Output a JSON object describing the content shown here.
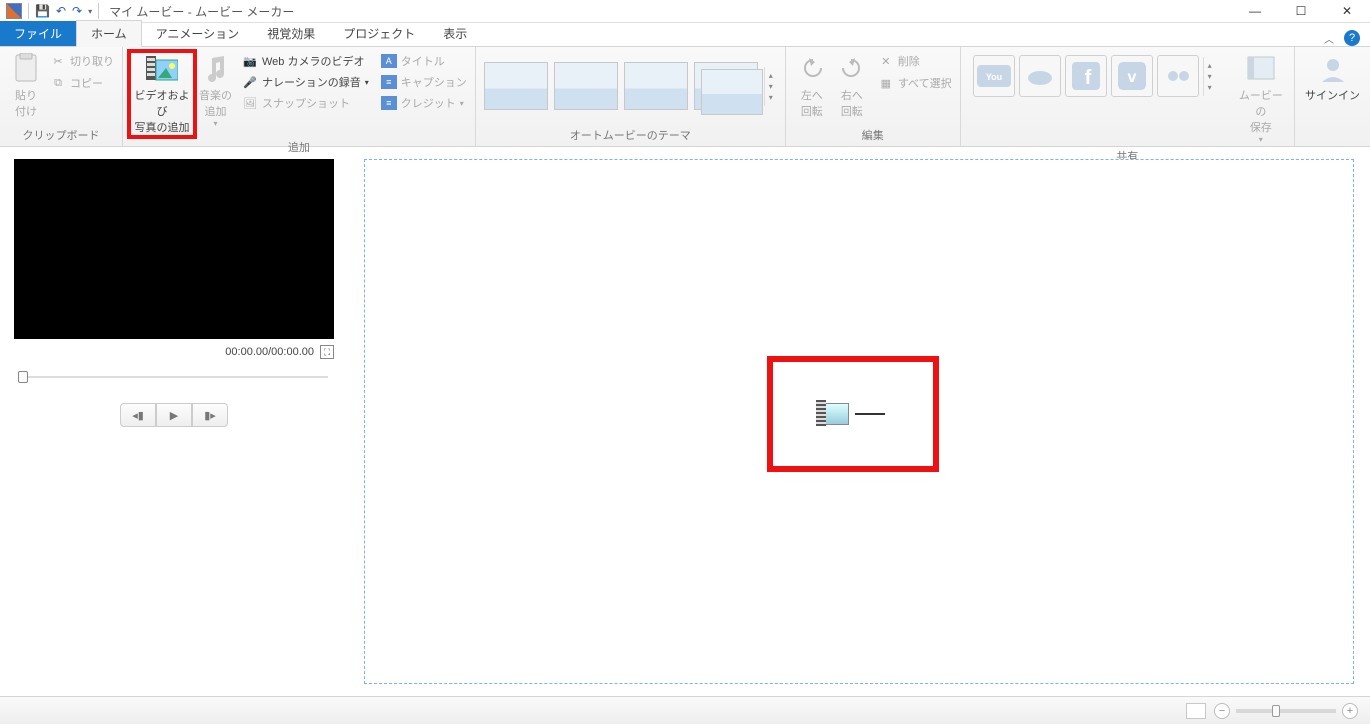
{
  "title": "マイ ムービー - ムービー メーカー",
  "tabs": {
    "file": "ファイル",
    "home": "ホーム",
    "animation": "アニメーション",
    "visual": "視覚効果",
    "project": "プロジェクト",
    "view": "表示"
  },
  "ribbon": {
    "clipboard": {
      "paste": "貼り\n付け",
      "cut": "切り取り",
      "copy": "コピー",
      "label": "クリップボード"
    },
    "add": {
      "video_photo": "ビデオおよび\n写真の追加",
      "music": "音楽の\n追加",
      "webcam": "Web カメラのビデオ",
      "narration": "ナレーションの録音",
      "snapshot": "スナップショット",
      "title": "タイトル",
      "caption": "キャプション",
      "credit": "クレジット",
      "label": "追加"
    },
    "automovie": {
      "label": "オートムービーのテーマ"
    },
    "edit": {
      "rotate_left": "左へ\n回転",
      "rotate_right": "右へ\n回転",
      "delete": "削除",
      "select_all": "すべて選択",
      "label": "編集"
    },
    "share": {
      "save_movie": "ムービーの\n保存",
      "label": "共有"
    },
    "signin": "サインイン"
  },
  "preview": {
    "time": "00:00.00/00:00.00"
  },
  "status": {}
}
